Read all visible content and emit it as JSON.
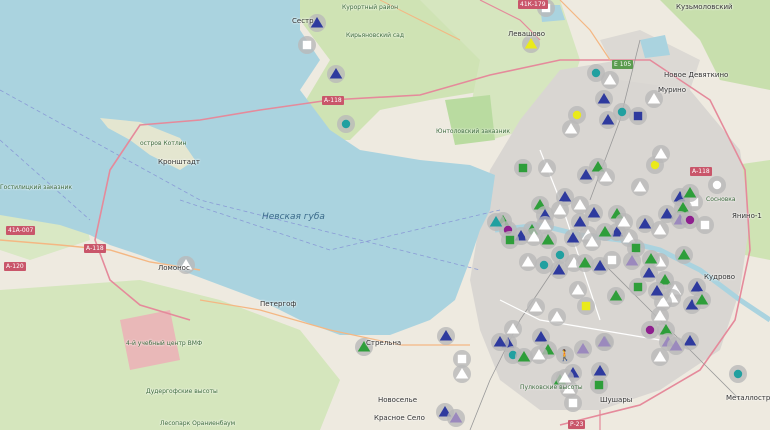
{
  "map": {
    "water_label": "Невская губа",
    "places": [
      {
        "text": "Сестр",
        "kind": "town"
      },
      {
        "text": "Курортный район",
        "kind": "small"
      },
      {
        "text": "Кузьмоловский",
        "kind": "town"
      },
      {
        "text": "Новое Девяткино",
        "kind": "town"
      },
      {
        "text": "Мурино",
        "kind": "town"
      },
      {
        "text": "Кронштадт",
        "kind": "town"
      },
      {
        "text": "остров Котлин",
        "kind": "small"
      },
      {
        "text": "Ломонос",
        "kind": "town"
      },
      {
        "text": "Петергоф",
        "kind": "town"
      },
      {
        "text": "Стрельна",
        "kind": "town"
      },
      {
        "text": "Новоселье",
        "kind": "town"
      },
      {
        "text": "Шушары",
        "kind": "town"
      },
      {
        "text": "Кудрово",
        "kind": "town"
      },
      {
        "text": "Янино-1",
        "kind": "town"
      },
      {
        "text": "Металлострой",
        "kind": "town"
      },
      {
        "text": "Юнтоловский заказник",
        "kind": "green"
      },
      {
        "text": "Кирьяновский сад",
        "kind": "green"
      },
      {
        "text": "Гостилицкий заказник",
        "kind": "green"
      },
      {
        "text": "Дудергофские высоты",
        "kind": "green"
      },
      {
        "text": "Пулковские высоты",
        "kind": "green"
      },
      {
        "text": "Лесопарк Ораниенбаум",
        "kind": "green"
      },
      {
        "text": "Сосновка",
        "kind": "green"
      },
      {
        "text": "4-й учебный центр ВМФ",
        "kind": "green"
      },
      {
        "text": "Левашово",
        "kind": "town"
      },
      {
        "text": "Красное Село",
        "kind": "town"
      }
    ],
    "roads": [
      {
        "text": "А-118"
      },
      {
        "text": "А-118"
      },
      {
        "text": "А-118"
      },
      {
        "text": "41К-179"
      },
      {
        "text": "41А-007"
      },
      {
        "text": "А-120"
      },
      {
        "text": "Р-23"
      },
      {
        "text": "Е 105"
      }
    ],
    "marker_colors": {
      "blue": "#2e3a9e",
      "green": "#2e9e3a",
      "teal": "#21a0a0",
      "yellow": "#eaea1a",
      "purple": "#8e1f8e",
      "lavender": "#9b89bd",
      "white": "#ffffff",
      "gray_disc": "#b9b9b9"
    },
    "markers": [
      {
        "shape": "triangle",
        "color": "blue"
      },
      {
        "shape": "square",
        "color": "white"
      },
      {
        "shape": "triangle",
        "color": "blue"
      },
      {
        "shape": "circle",
        "color": "teal"
      },
      {
        "shape": "triangle",
        "color": "yellow"
      },
      {
        "shape": "square",
        "color": "white"
      },
      {
        "shape": "circle",
        "color": "teal"
      },
      {
        "shape": "triangle",
        "color": "white"
      },
      {
        "shape": "triangle",
        "color": "blue"
      },
      {
        "shape": "circle",
        "color": "teal"
      },
      {
        "shape": "square",
        "color": "blue"
      },
      {
        "shape": "triangle",
        "color": "white"
      },
      {
        "shape": "circle",
        "color": "yellow"
      },
      {
        "shape": "triangle",
        "color": "blue"
      },
      {
        "shape": "triangle",
        "color": "white"
      },
      {
        "shape": "triangle",
        "color": "blue"
      },
      {
        "shape": "square",
        "color": "green"
      },
      {
        "shape": "triangle",
        "color": "white"
      },
      {
        "shape": "triangle",
        "color": "green"
      },
      {
        "shape": "triangle",
        "color": "white"
      },
      {
        "shape": "circle",
        "color": "yellow"
      },
      {
        "shape": "triangle",
        "color": "white"
      },
      {
        "shape": "triangle",
        "color": "white"
      },
      {
        "shape": "triangle",
        "color": "blue"
      },
      {
        "shape": "square",
        "color": "white"
      },
      {
        "shape": "triangle",
        "color": "green"
      },
      {
        "shape": "circle",
        "color": "white"
      },
      {
        "shape": "triangle",
        "color": "blue"
      },
      {
        "shape": "triangle",
        "color": "white"
      },
      {
        "shape": "triangle",
        "color": "green"
      },
      {
        "shape": "triangle",
        "color": "white"
      },
      {
        "shape": "triangle",
        "color": "green"
      },
      {
        "shape": "triangle",
        "color": "blue"
      },
      {
        "shape": "triangle",
        "color": "white"
      },
      {
        "shape": "triangle",
        "color": "white"
      },
      {
        "shape": "triangle",
        "color": "blue"
      },
      {
        "shape": "triangle",
        "color": "green"
      },
      {
        "shape": "circle",
        "color": "purple"
      },
      {
        "shape": "triangle",
        "color": "teal"
      },
      {
        "shape": "triangle",
        "color": "blue"
      },
      {
        "shape": "triangle",
        "color": "white"
      },
      {
        "shape": "square",
        "color": "green"
      },
      {
        "shape": "triangle",
        "color": "green"
      },
      {
        "shape": "triangle",
        "color": "blue"
      },
      {
        "shape": "triangle",
        "color": "white"
      },
      {
        "shape": "triangle",
        "color": "green"
      },
      {
        "shape": "circle",
        "color": "teal"
      },
      {
        "shape": "triangle",
        "color": "blue"
      },
      {
        "shape": "triangle",
        "color": "blue"
      },
      {
        "shape": "triangle",
        "color": "white"
      },
      {
        "shape": "triangle",
        "color": "green"
      },
      {
        "shape": "triangle",
        "color": "white"
      },
      {
        "shape": "triangle",
        "color": "blue"
      },
      {
        "shape": "square",
        "color": "green"
      },
      {
        "shape": "triangle",
        "color": "white"
      },
      {
        "shape": "triangle",
        "color": "blue"
      },
      {
        "shape": "triangle",
        "color": "green"
      },
      {
        "shape": "triangle",
        "color": "lavender"
      },
      {
        "shape": "circle",
        "color": "purple"
      },
      {
        "shape": "square",
        "color": "white"
      },
      {
        "shape": "triangle",
        "color": "green"
      },
      {
        "shape": "triangle",
        "color": "white"
      },
      {
        "shape": "triangle",
        "color": "blue"
      },
      {
        "shape": "triangle",
        "color": "green"
      },
      {
        "shape": "triangle",
        "color": "white"
      },
      {
        "shape": "triangle",
        "color": "blue"
      },
      {
        "shape": "square",
        "color": "green"
      },
      {
        "shape": "triangle",
        "color": "white"
      },
      {
        "shape": "triangle",
        "color": "blue"
      },
      {
        "shape": "triangle",
        "color": "green"
      },
      {
        "shape": "triangle",
        "color": "white"
      },
      {
        "shape": "triangle",
        "color": "blue"
      },
      {
        "shape": "triangle",
        "color": "green"
      },
      {
        "shape": "triangle",
        "color": "white"
      },
      {
        "shape": "circle",
        "color": "teal"
      },
      {
        "shape": "triangle",
        "color": "blue"
      },
      {
        "shape": "triangle",
        "color": "white"
      },
      {
        "shape": "triangle",
        "color": "green"
      },
      {
        "shape": "triangle",
        "color": "blue"
      },
      {
        "shape": "square",
        "color": "white"
      },
      {
        "shape": "triangle",
        "color": "lavender"
      },
      {
        "shape": "triangle",
        "color": "green"
      },
      {
        "shape": "triangle",
        "color": "white"
      },
      {
        "shape": "square",
        "color": "yellow"
      },
      {
        "shape": "triangle",
        "color": "white"
      },
      {
        "shape": "circle",
        "color": "purple"
      },
      {
        "shape": "triangle",
        "color": "green"
      },
      {
        "shape": "triangle",
        "color": "lavender"
      },
      {
        "shape": "triangle",
        "color": "blue"
      },
      {
        "shape": "triangle",
        "color": "white"
      },
      {
        "shape": "triangle",
        "color": "lavender"
      },
      {
        "shape": "triangle",
        "color": "blue"
      },
      {
        "shape": "triangle",
        "color": "white"
      },
      {
        "shape": "triangle",
        "color": "white"
      },
      {
        "shape": "triangle",
        "color": "lavender"
      },
      {
        "shape": "triangle",
        "color": "blue"
      },
      {
        "shape": "triangle",
        "color": "green"
      },
      {
        "shape": "triangle",
        "color": "white"
      },
      {
        "shape": "triangle",
        "color": "blue"
      },
      {
        "shape": "triangle",
        "color": "blue"
      },
      {
        "shape": "circle",
        "color": "teal"
      },
      {
        "shape": "triangle",
        "color": "green"
      },
      {
        "shape": "triangle",
        "color": "white"
      },
      {
        "shape": "person",
        "color": "white"
      },
      {
        "shape": "triangle",
        "color": "lavender"
      },
      {
        "shape": "triangle",
        "color": "white"
      },
      {
        "shape": "triangle",
        "color": "blue"
      },
      {
        "shape": "square",
        "color": "green"
      },
      {
        "shape": "triangle",
        "color": "blue"
      },
      {
        "shape": "triangle",
        "color": "green"
      },
      {
        "shape": "square",
        "color": "white"
      },
      {
        "shape": "triangle",
        "color": "white"
      },
      {
        "shape": "triangle",
        "color": "blue"
      },
      {
        "shape": "triangle",
        "color": "lavender"
      },
      {
        "shape": "circle",
        "color": "teal"
      },
      {
        "shape": "triangle",
        "color": "white"
      },
      {
        "shape": "triangle",
        "color": "blue"
      },
      {
        "shape": "triangle",
        "color": "green"
      },
      {
        "shape": "square",
        "color": "white"
      },
      {
        "shape": "triangle",
        "color": "white"
      }
    ]
  }
}
